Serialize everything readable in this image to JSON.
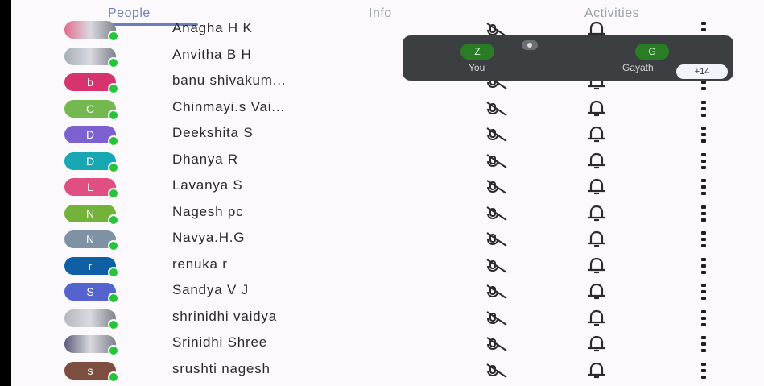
{
  "tabs": {
    "people": "People",
    "info": "Info",
    "activities": "Activities"
  },
  "stage": {
    "you_initial": "Z",
    "you_label": "You",
    "guest_initial": "G",
    "guest_label": "Gayath",
    "more_count": "+14"
  },
  "participants": [
    {
      "name": "Anagha H K",
      "initial": "",
      "color": "#e36c8d"
    },
    {
      "name": "Anvitha B H",
      "initial": "",
      "color": "#a8afb8"
    },
    {
      "name": "banu shivakum...",
      "initial": "b",
      "color": "#d7336f"
    },
    {
      "name": "Chinmayi.s Vai...",
      "initial": "C",
      "color": "#74b850"
    },
    {
      "name": "Deekshita S",
      "initial": "D",
      "color": "#7d61d0"
    },
    {
      "name": "Dhanya R",
      "initial": "D",
      "color": "#18a8b4"
    },
    {
      "name": "Lavanya S",
      "initial": "L",
      "color": "#e04f81"
    },
    {
      "name": "Nagesh pc",
      "initial": "N",
      "color": "#73b339"
    },
    {
      "name": "Navya.H.G",
      "initial": "N",
      "color": "#7f92a4"
    },
    {
      "name": "renuka r",
      "initial": "r",
      "color": "#0f5fa5"
    },
    {
      "name": "Sandya V J",
      "initial": "S",
      "color": "#5563cf"
    },
    {
      "name": "shrinidhi vaidya",
      "initial": "",
      "color": "#b6b8bd"
    },
    {
      "name": "Srinidhi Shree",
      "initial": "",
      "color": "#5c5d7b"
    },
    {
      "name": "srushti nagesh",
      "initial": "s",
      "color": "#7d4e3f"
    }
  ]
}
